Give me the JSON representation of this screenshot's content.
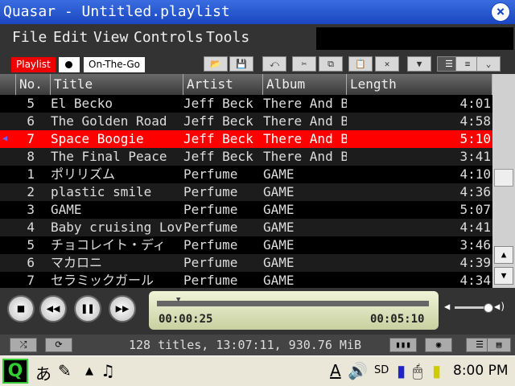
{
  "window": {
    "title": "Quasar - Untitled.playlist",
    "close": "×"
  },
  "menu": [
    "File",
    "Edit",
    "View",
    "Controls",
    "Tools"
  ],
  "tabs": {
    "playlist": "Playlist",
    "on_the_go": "On-The-Go"
  },
  "columns": {
    "no": "No.",
    "title": "Title",
    "artist": "Artist",
    "album": "Album",
    "length": "Length"
  },
  "rows": [
    {
      "no": "5",
      "title": "El Becko",
      "artist": "Jeff Beck",
      "album": "There And Ba",
      "length": "4:01"
    },
    {
      "no": "6",
      "title": "The Golden Road",
      "artist": "Jeff Beck",
      "album": "There And Ba",
      "length": "4:58"
    },
    {
      "no": "7",
      "title": "Space Boogie",
      "artist": "Jeff Beck",
      "album": "There And Ba",
      "length": "5:10"
    },
    {
      "no": "8",
      "title": "The Final Peace",
      "artist": "Jeff Beck",
      "album": "There And Ba",
      "length": "3:41"
    },
    {
      "no": "1",
      "title": "ポリリズム",
      "artist": "Perfume",
      "album": "GAME",
      "length": "4:10"
    },
    {
      "no": "2",
      "title": "plastic smile",
      "artist": "Perfume",
      "album": "GAME",
      "length": "4:36"
    },
    {
      "no": "3",
      "title": "GAME",
      "artist": "Perfume",
      "album": "GAME",
      "length": "5:07"
    },
    {
      "no": "4",
      "title": "Baby cruising Love",
      "artist": "Perfume",
      "album": "GAME",
      "length": "4:41"
    },
    {
      "no": "5",
      "title": "チョコレイト・ディ",
      "artist": "Perfume",
      "album": "GAME",
      "length": "3:46"
    },
    {
      "no": "6",
      "title": "マカロニ",
      "artist": "Perfume",
      "album": "GAME",
      "length": "4:39"
    },
    {
      "no": "7",
      "title": "セラミックガール",
      "artist": "Perfume",
      "album": "GAME",
      "length": "4:34"
    }
  ],
  "selected_row": 2,
  "playback": {
    "current": "00:00:25",
    "total": "00:05:10",
    "progress": 0.08,
    "volume": 0.9
  },
  "status": {
    "summary": "128 titles, 13:07:11, 930.76 MiB"
  },
  "taskbar": {
    "input_method": "あ",
    "ime_indicator": "A",
    "clock": "8:00 PM"
  },
  "colors": {
    "selection": "#ff0000",
    "title_bar": "#2a58d0",
    "launcher": "#33cc33"
  }
}
